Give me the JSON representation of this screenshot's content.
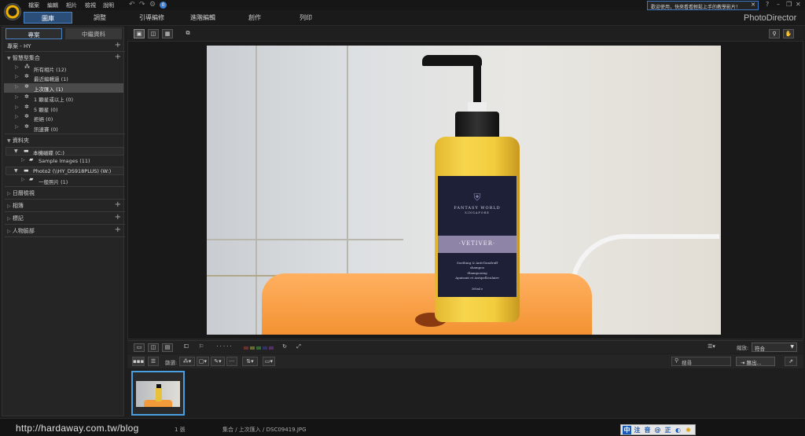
{
  "menu": [
    "檔案",
    "編輯",
    "相片",
    "檢視",
    "說明"
  ],
  "notification": "歡迎使用，快來看看輕鬆上手的教學影片！",
  "brand": "PhotoDirector",
  "modules": [
    {
      "label": "圖庫",
      "active": true
    },
    {
      "label": "調整",
      "active": false
    },
    {
      "label": "引導編修",
      "active": false
    },
    {
      "label": "進階編輯",
      "active": false
    },
    {
      "label": "創作",
      "active": false
    },
    {
      "label": "列印",
      "active": false
    }
  ],
  "panel_tabs": {
    "project": "專案",
    "metadata": "中繼資料"
  },
  "project_header": "專案 - HY",
  "smart_collections": {
    "title": "智慧型集合",
    "items": [
      {
        "label": "所有相片 (12)",
        "icon": "all-photos-icon",
        "selected": false
      },
      {
        "label": "最近編輯過 (1)",
        "icon": "recent-edit-icon",
        "selected": false
      },
      {
        "label": "上次匯入 (1)",
        "icon": "last-import-icon",
        "selected": true
      },
      {
        "label": "1 顆星或以上 (0)",
        "icon": "star-icon",
        "selected": false
      },
      {
        "label": "5 顆星 (0)",
        "icon": "five-star-icon",
        "selected": false
      },
      {
        "label": "拒絕 (0)",
        "icon": "reject-icon",
        "selected": false
      },
      {
        "label": "訊速賽 (0)",
        "icon": "flag-icon",
        "selected": false
      }
    ]
  },
  "folders": {
    "title": "資料夾",
    "drives": [
      {
        "label": "本機磁碟 (C:)",
        "children": [
          {
            "label": "Sample Images (11)"
          }
        ]
      },
      {
        "label": "Photo2 (\\\\HY_DS918PLUS) (W:)",
        "children": [
          {
            "label": "一般照片 (1)"
          }
        ]
      }
    ]
  },
  "sections": [
    "日曆檢視",
    "相簿",
    "標記",
    "人物臉部"
  ],
  "photo": {
    "brand_line1": "FANTASY WORLD",
    "brand_line2": "SINGAPORE",
    "product": "·VETIVER·",
    "desc1": "Soothing & Anti-Dandruff",
    "desc2": "shampoo",
    "desc3": "Shampooing",
    "desc4": "Apaisant et Antipelliculaire",
    "volume": "300ml e"
  },
  "infobar": {
    "zoom_label": "縮放:",
    "zoom_value": "符合"
  },
  "filterbar": {
    "filter_label": "篩選:",
    "search_placeholder": "搜尋",
    "export_label": "匯出..."
  },
  "status": {
    "watermark": "http://hardaway.com.tw/blog",
    "count": "1 張",
    "path": "集合 / 上次匯入 / DSC09419.JPG"
  },
  "ime": [
    "注",
    "音",
    "@",
    "正",
    "◐"
  ],
  "colors": {
    "accent": "#4a82c3",
    "selection": "#4a4a4a",
    "thumb_border": "#4a9fe0"
  }
}
